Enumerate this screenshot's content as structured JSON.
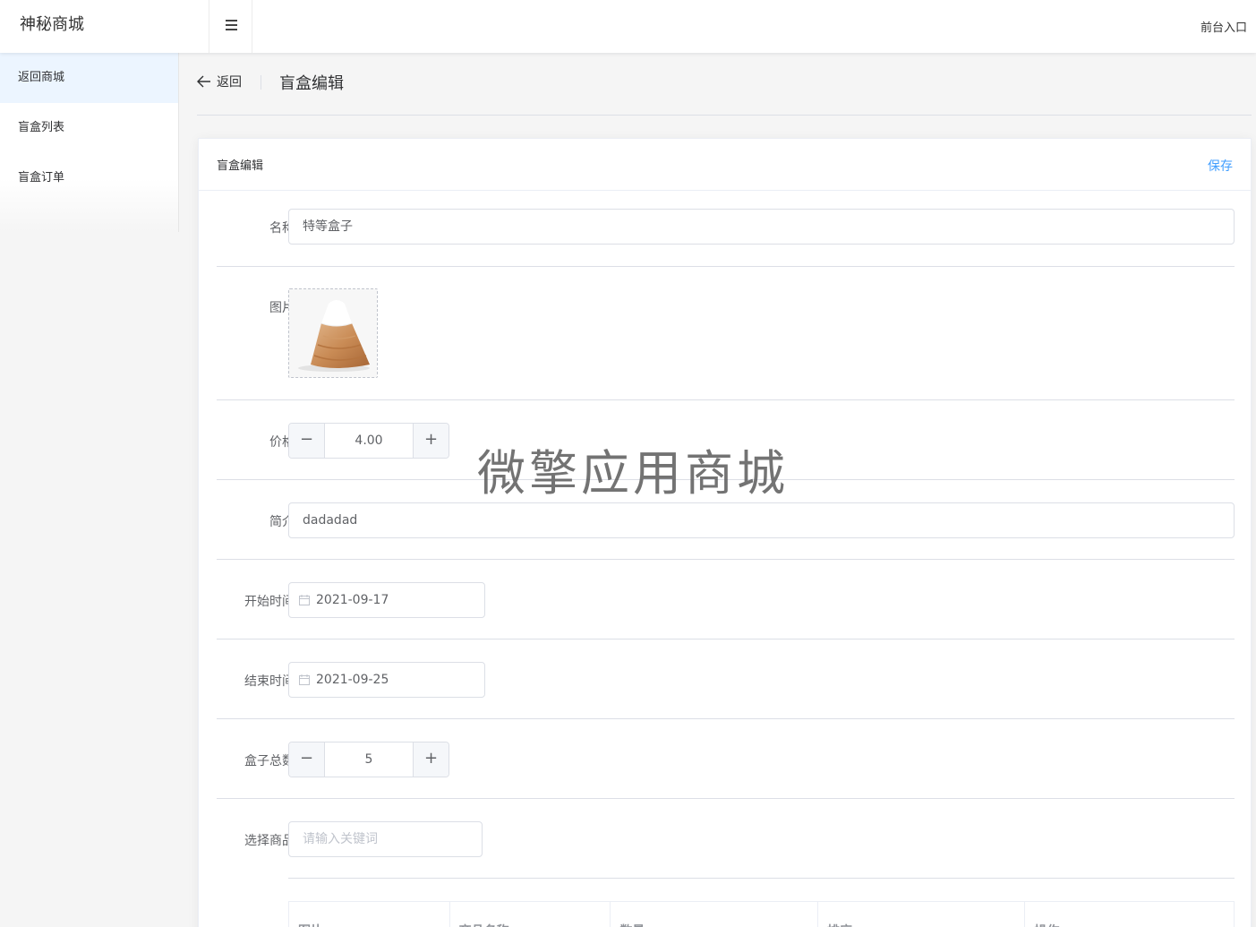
{
  "header": {
    "brand": "神秘商城",
    "front_link": "前台入口"
  },
  "sidebar": {
    "items": [
      {
        "label": "返回商城",
        "active": true
      },
      {
        "label": "盲盒列表",
        "active": false
      },
      {
        "label": "盲盒订单",
        "active": false
      }
    ]
  },
  "page_header": {
    "back_label": "返回",
    "title": "盲盒编辑"
  },
  "card": {
    "title": "盲盒编辑",
    "save_label": "保存"
  },
  "form": {
    "name": {
      "label": "名称",
      "value": "特等盒子"
    },
    "image": {
      "label": "图片"
    },
    "price": {
      "label": "价格",
      "value": "4.00",
      "minus": "−",
      "plus": "+"
    },
    "intro": {
      "label": "简介",
      "value": "dadadad"
    },
    "start_time": {
      "label": "开始时间",
      "value": "2021-09-17"
    },
    "end_time": {
      "label": "结束时间",
      "value": "2021-09-25"
    },
    "box_total": {
      "label": "盒子总数",
      "value": "5",
      "minus": "−",
      "plus": "+"
    },
    "select_goods": {
      "label": "选择商品",
      "placeholder": "请输入关键词"
    }
  },
  "table": {
    "columns": [
      "图片",
      "商品名称",
      "数量",
      "排序",
      "操作"
    ]
  },
  "watermark": "微擎应用商城",
  "colors": {
    "accent": "#409eff",
    "active_menu_bg": "#ecf5ff"
  }
}
